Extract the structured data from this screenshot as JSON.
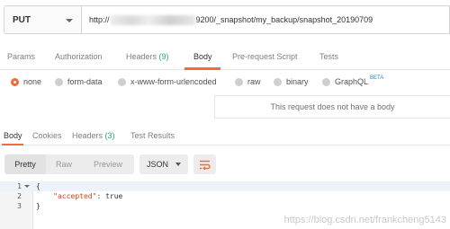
{
  "request": {
    "method": "PUT",
    "url_prefix": "http://",
    "url_suffix": "9200/_snapshot/my_backup/snapshot_20190709"
  },
  "request_tabs": [
    {
      "label": "Params"
    },
    {
      "label": "Authorization"
    },
    {
      "label": "Headers",
      "count": "(9)"
    },
    {
      "label": "Body",
      "active": true
    },
    {
      "label": "Pre-request Script"
    },
    {
      "label": "Tests"
    }
  ],
  "body_types": [
    {
      "label": "none",
      "selected": true
    },
    {
      "label": "form-data"
    },
    {
      "label": "x-www-form-urlencoded"
    },
    {
      "label": "raw"
    },
    {
      "label": "binary"
    },
    {
      "label": "GraphQL",
      "badge": "BETA"
    }
  ],
  "body_note": "This request does not have a body",
  "response_tabs": [
    {
      "label": "Body",
      "active": true
    },
    {
      "label": "Cookies"
    },
    {
      "label": "Headers",
      "count": "(3)"
    },
    {
      "label": "Test Results"
    }
  ],
  "view_modes": [
    "Pretty",
    "Raw",
    "Preview"
  ],
  "format": "JSON",
  "code_lines": [
    {
      "num": "1",
      "text": "{"
    },
    {
      "num": "2",
      "key": "\"accepted\"",
      "rest": ": true"
    },
    {
      "num": "3",
      "text": "}"
    }
  ],
  "watermark": "https://blog.csdn.net/frankcheng5143",
  "colors": {
    "accent": "#f26b3a",
    "count": "#26a96b",
    "beta": "#2d7bd8"
  },
  "icons": {
    "method_dropdown": "chevron-down-icon",
    "wrap": "wrap-lines-icon",
    "fold": "fold-arrow-icon"
  }
}
